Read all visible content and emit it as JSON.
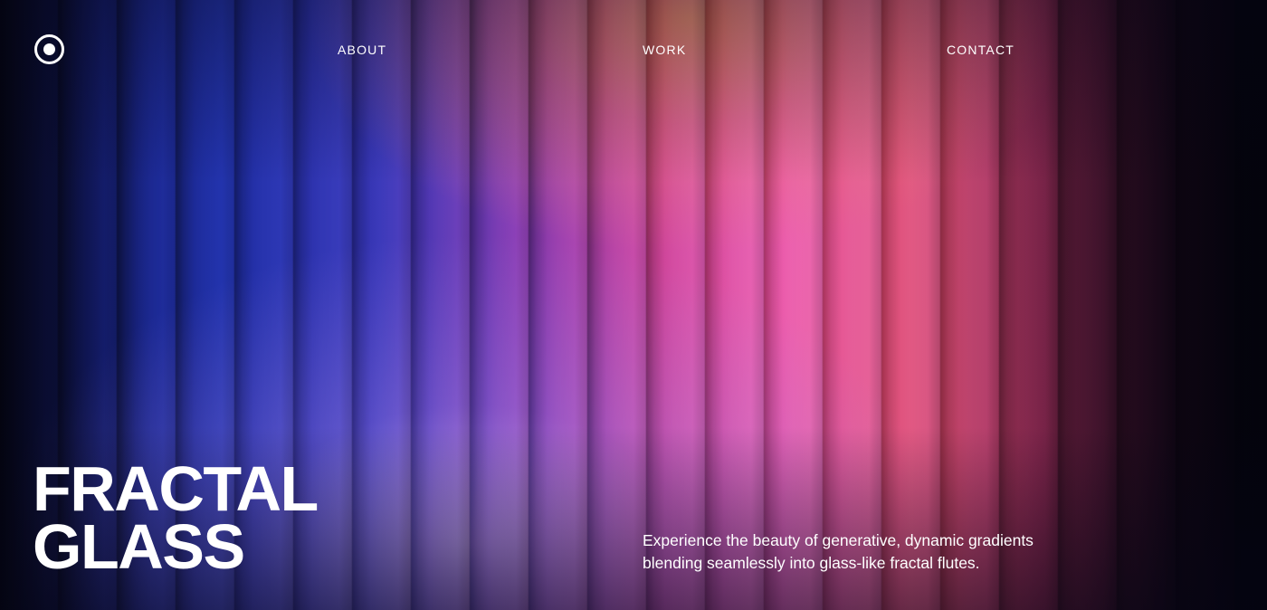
{
  "header": {
    "logo_icon": "target-circle-icon",
    "nav": {
      "about": "ABOUT",
      "work": "WORK",
      "contact": "CONTACT"
    }
  },
  "hero": {
    "title_line_1": "FRACTAL",
    "title_line_2": "GLASS",
    "description_line_1": "Experience the beauty of generative, dynamic gradients",
    "description_line_2": "blending seamlessly into glass-like fractal flutes."
  },
  "colors": {
    "text": "#ffffff",
    "gradient_left": "#16207a",
    "gradient_mid": "#ec5fae",
    "gradient_glow": "#e88c60",
    "gradient_right": "#07040e"
  }
}
